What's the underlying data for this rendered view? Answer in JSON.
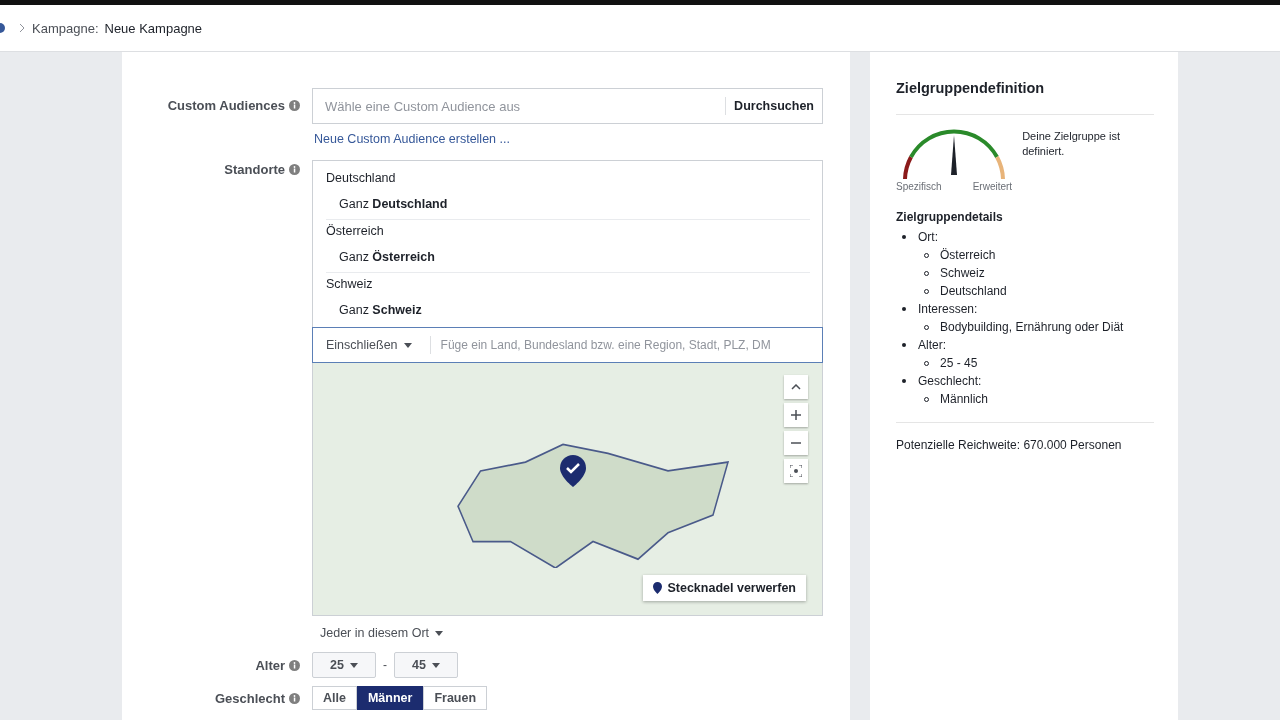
{
  "breadcrumb": {
    "label": "Kampagne:",
    "value": "Neue Kampagne"
  },
  "form": {
    "custom_audiences": {
      "label": "Custom Audiences",
      "placeholder": "Wähle eine Custom Audience aus",
      "browse_button": "Durchsuchen",
      "create_link": "Neue Custom Audience erstellen ..."
    },
    "locations": {
      "label": "Standorte",
      "groups": [
        {
          "country": "Deutschland",
          "scope": "Ganz **Deutschland**"
        },
        {
          "country": "Österreich",
          "scope": "Ganz **Österreich**"
        },
        {
          "country": "Schweiz",
          "scope": "Ganz **Schweiz**"
        }
      ],
      "include_dropdown": "Einschließen",
      "placeholder": "Füge ein Land, Bundesland bzw. eine Region, Stadt, PLZ, DM",
      "drop_pin_button": "Stecknadel verwerfen",
      "audience_dropdown": "Jeder in diesem Ort"
    },
    "age": {
      "label": "Alter",
      "min": "25",
      "separator": "-",
      "max": "45"
    },
    "gender": {
      "label": "Geschlecht",
      "options": [
        {
          "label": "Alle",
          "selected": false
        },
        {
          "label": "Männer",
          "selected": true
        },
        {
          "label": "Frauen",
          "selected": false
        }
      ]
    }
  },
  "panel": {
    "title": "Zielgruppendefinition",
    "gauge": {
      "left_label": "Spezifisch",
      "right_label": "Erweitert",
      "message": "Deine Zielgruppe ist definiert."
    },
    "details_title": "Zielgruppendetails",
    "details": [
      {
        "label": "Ort:",
        "children": [
          "Österreich",
          "Schweiz",
          "Deutschland"
        ]
      },
      {
        "label": "Interessen:",
        "children": [
          "Bodybuilding, Ernährung oder Diät"
        ]
      },
      {
        "label": "Alter:",
        "children": [
          "25 - 45"
        ]
      },
      {
        "label": "Geschlecht:",
        "children": [
          "Männlich"
        ]
      }
    ],
    "reach": "Potenzielle Reichweite: 670.000 Personen"
  }
}
